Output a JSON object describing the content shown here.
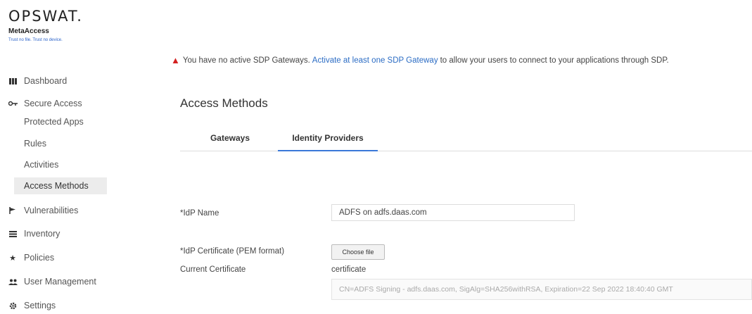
{
  "brand": {
    "logo": "OPSWAT.",
    "product": "MetaAccess",
    "tagline": "Trust no file. Trust no device."
  },
  "sidebar": {
    "items": [
      {
        "label": "Dashboard",
        "icon": "bar-chart-icon"
      },
      {
        "label": "Secure Access",
        "icon": "key-icon"
      },
      {
        "label": "Vulnerabilities",
        "icon": "flag-icon"
      },
      {
        "label": "Inventory",
        "icon": "list-icon"
      },
      {
        "label": "Policies",
        "icon": "star-icon"
      },
      {
        "label": "User Management",
        "icon": "users-icon"
      },
      {
        "label": "Settings",
        "icon": "gear-icon"
      }
    ],
    "sub_items": [
      {
        "label": "Protected Apps"
      },
      {
        "label": "Rules"
      },
      {
        "label": "Activities"
      },
      {
        "label": "Access Methods",
        "active": true
      }
    ]
  },
  "alert": {
    "text_before": "You have no active SDP Gateways.",
    "link": "Activate at least one SDP Gateway",
    "text_after": "to allow your users to connect to your applications through SDP."
  },
  "main": {
    "title": "Access Methods",
    "tabs": [
      {
        "label": "Gateways",
        "active": false
      },
      {
        "label": "Identity Providers",
        "active": true
      }
    ]
  },
  "form": {
    "idp_name_label": "*IdP Name",
    "idp_name_value": "ADFS on adfs.daas.com",
    "idp_cert_label": "*IdP Certificate (PEM format)",
    "choose_file_label": "Choose file",
    "current_cert_label": "Current Certificate",
    "cert_filename": "certificate",
    "cert_details": "CN=ADFS Signing - adfs.daas.com, SigAlg=SHA256withRSA, Expiration=22 Sep 2022 18:40:40 GMT"
  },
  "colors": {
    "accent": "#3a78d8",
    "link": "#2b6cc4",
    "warning": "#d32020",
    "active_bg": "#ececec"
  }
}
